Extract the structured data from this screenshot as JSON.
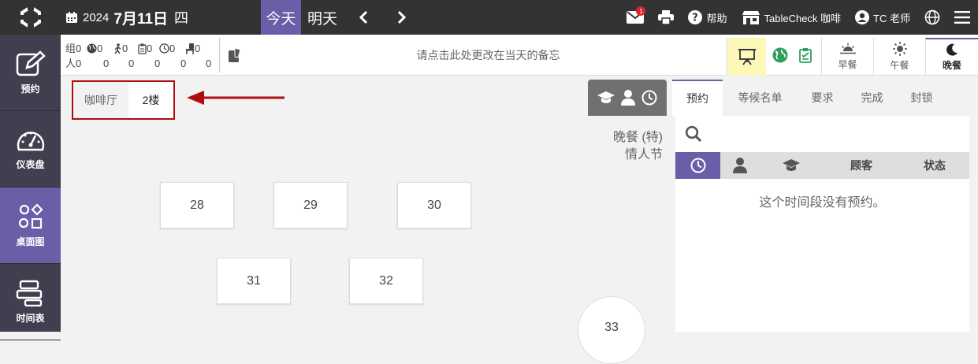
{
  "topbar": {
    "year": "2024",
    "month_day": "7月11日",
    "weekday": "四",
    "today_label": "今天",
    "tomorrow_label": "明天",
    "mail_badge": "1",
    "help_label": "帮助",
    "shop_label": "TableCheck 咖啡",
    "user_label": "TC 老师"
  },
  "leftnav": {
    "items": [
      {
        "label": "预约",
        "icon": "edit-icon"
      },
      {
        "label": "仪表盘",
        "icon": "dashboard-icon"
      },
      {
        "label": "桌面图",
        "icon": "table-map-icon"
      },
      {
        "label": "时间表",
        "icon": "timeline-icon"
      }
    ]
  },
  "stats": {
    "row1_prefix": "组",
    "row2_prefix": "人",
    "row1_values": [
      "0",
      "0",
      "0",
      "0",
      "0",
      "0"
    ],
    "row2_values": [
      "0",
      "0",
      "0",
      "0",
      "0",
      "0"
    ]
  },
  "memo_placeholder": "请点击此处更改在当天的备忘",
  "meals": [
    {
      "label": "早餐",
      "icon": "sunrise-icon"
    },
    {
      "label": "午餐",
      "icon": "sun-icon"
    },
    {
      "label": "晚餐",
      "icon": "moon-icon"
    }
  ],
  "floors": [
    "咖啡厅",
    "2楼"
  ],
  "event": {
    "line1": "晚餐 (特)",
    "line2": "情人节"
  },
  "tables": [
    "28",
    "29",
    "30",
    "31",
    "32",
    "33"
  ],
  "rpanel": {
    "tabs": [
      "预约",
      "等候名单",
      "要求",
      "完成",
      "封锁"
    ],
    "columns": {
      "guest": "顾客",
      "status": "状态"
    },
    "empty_text": "这个时间段没有预约。"
  },
  "colors": {
    "accent": "#6b5da8",
    "topbar": "#333333",
    "highlight": "#b00d0d"
  }
}
